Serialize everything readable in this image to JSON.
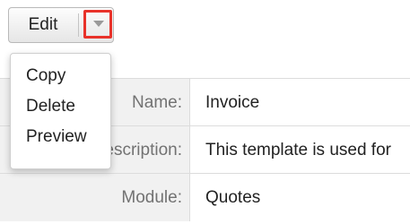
{
  "toolbar": {
    "edit_label": "Edit",
    "toggle_icon": "caret-down-icon",
    "highlight_color": "#e8322a"
  },
  "menu": {
    "items": [
      {
        "label": "Copy"
      },
      {
        "label": "Delete"
      },
      {
        "label": "Preview"
      }
    ]
  },
  "record": {
    "fields": [
      {
        "label": "Name:",
        "value": "Invoice"
      },
      {
        "label": "Description:",
        "value": "This template is used for"
      },
      {
        "label": "Module:",
        "value": "Quotes"
      }
    ]
  }
}
